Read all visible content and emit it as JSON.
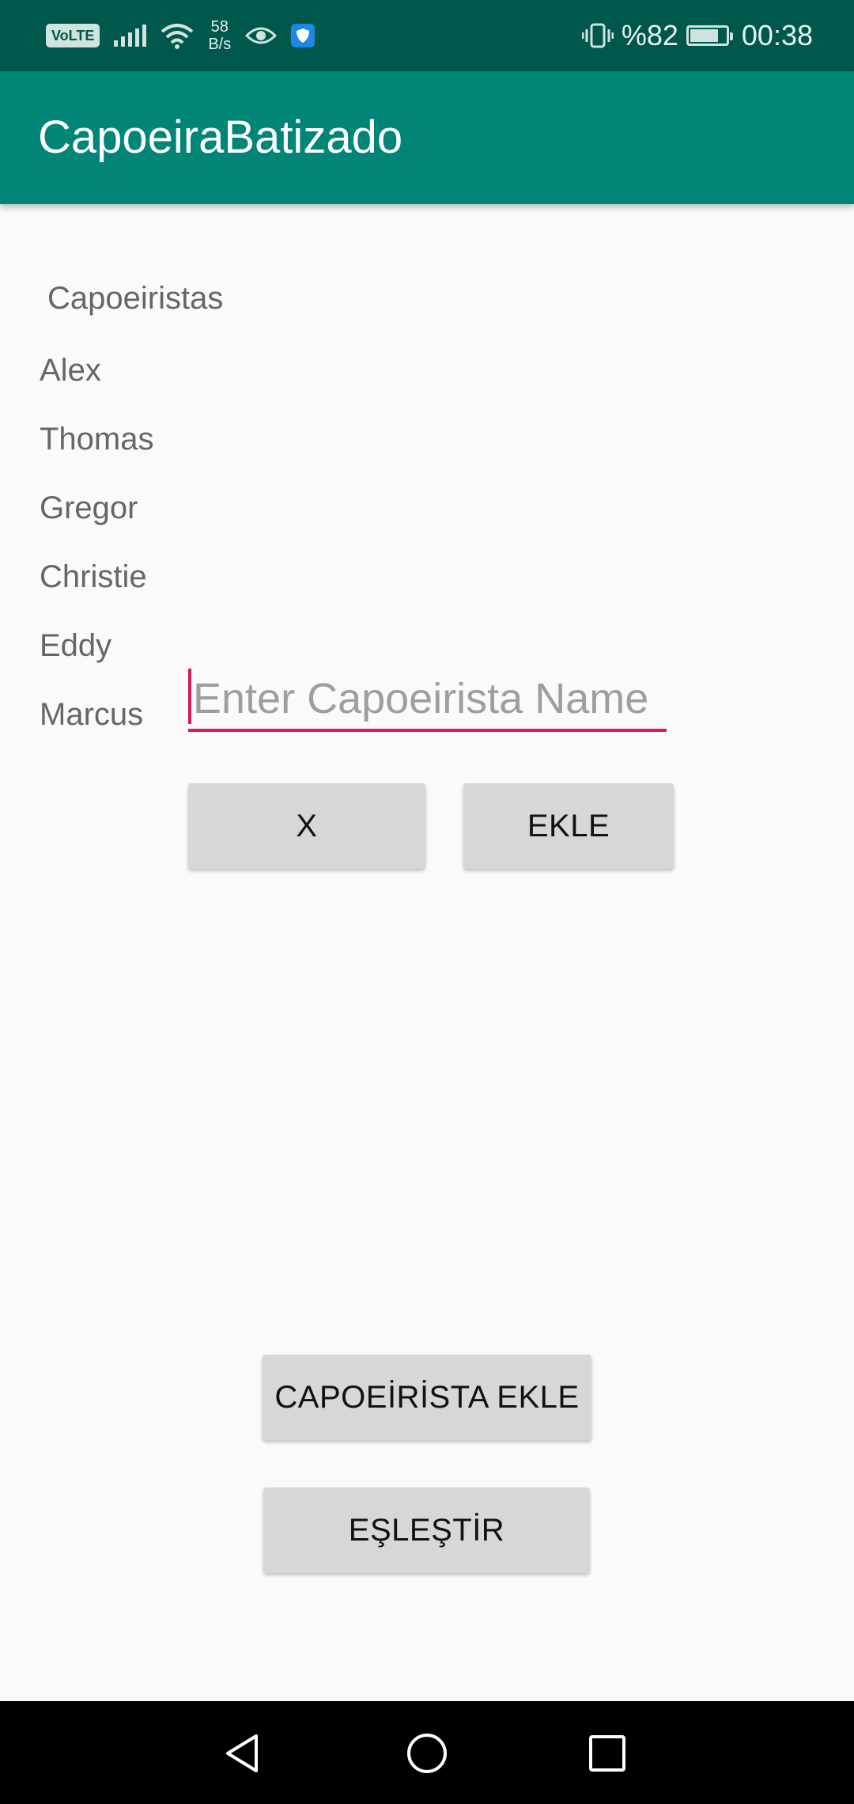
{
  "status_bar": {
    "volte": "VoLTE",
    "speed_value": "58",
    "speed_unit": "B/s",
    "battery_text": "%82",
    "battery_level": 0.82,
    "time": "00:38",
    "icons": [
      "volte-icon",
      "signal-icon",
      "wifi-icon",
      "eye-icon",
      "shield-icon",
      "vibrate-icon",
      "battery-icon"
    ]
  },
  "app_bar": {
    "title": "CapoeiraBatizado"
  },
  "list": {
    "header": "Capoeiristas",
    "items": [
      "Alex",
      "Thomas",
      "Gregor",
      "Christie",
      "Eddy",
      "Marcus"
    ]
  },
  "input": {
    "placeholder": "Enter Capoeirista Name",
    "value": ""
  },
  "buttons": {
    "cancel": "X",
    "add": "EKLE",
    "add_capoeirista": "CAPOEİRİSTA EKLE",
    "match": "EŞLEŞTİR"
  },
  "nav_bar": {
    "icons": [
      "back-icon",
      "home-icon",
      "recents-icon"
    ]
  },
  "colors": {
    "status_bar": "#00574b",
    "app_bar": "#008577",
    "accent": "#d81b60",
    "button": "#d6d7d7"
  }
}
